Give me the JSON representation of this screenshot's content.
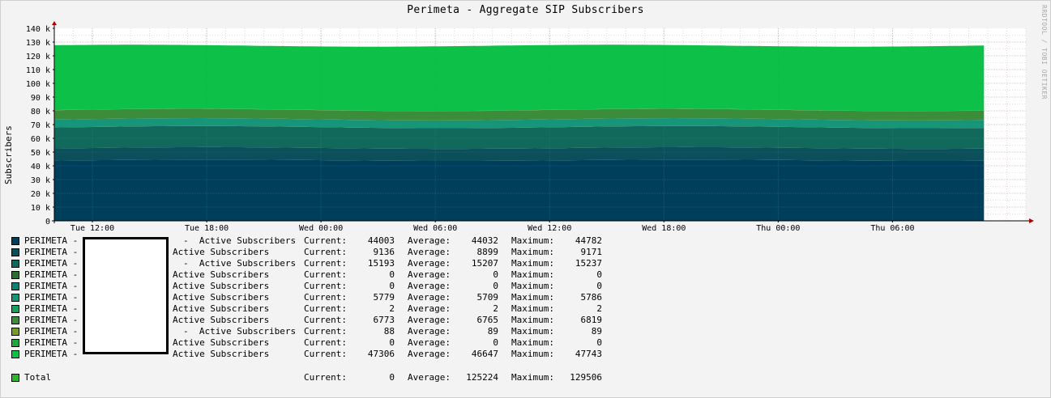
{
  "title": "Perimeta - Aggregate SIP Subscribers",
  "watermark": "RRDTOOL / TOBI OETIKER",
  "chart_data": {
    "type": "area",
    "stacked": true,
    "title": "Perimeta - Aggregate SIP Subscribers",
    "ylabel": "Subscribers",
    "xlabel": "",
    "ylim": [
      0,
      140000
    ],
    "y_ticks": [
      "0",
      "10 k",
      "20 k",
      "30 k",
      "40 k",
      "50 k",
      "60 k",
      "70 k",
      "80 k",
      "90 k",
      "100 k",
      "110 k",
      "120 k",
      "130 k",
      "140 k"
    ],
    "x_ticks": [
      "Tue 12:00",
      "Tue 18:00",
      "Wed 00:00",
      "Wed 06:00",
      "Wed 12:00",
      "Wed 18:00",
      "Thu 00:00",
      "Thu 06:00"
    ],
    "x_range_hours": [
      -2,
      49
    ],
    "grid": true,
    "series": [
      {
        "name": "PERIMETA -",
        "desc": "-  Active Subscribers",
        "color": "#003f5c",
        "current": 44003,
        "average": 44032,
        "maximum": 44782
      },
      {
        "name": "PERIMETA -",
        "desc": "Active Subscribers",
        "color": "#0b4f5b",
        "current": 9136,
        "average": 8899,
        "maximum": 9171
      },
      {
        "name": "PERIMETA -",
        "desc": "-  Active Subscribers",
        "color": "#10695a",
        "current": 15193,
        "average": 15207,
        "maximum": 15237
      },
      {
        "name": "PERIMETA -",
        "desc": "Active Subscribers",
        "color": "#2a6f2f",
        "current": 0,
        "average": 0,
        "maximum": 0
      },
      {
        "name": "PERIMETA -",
        "desc": "Active Subscribers",
        "color": "#127f75",
        "current": 0,
        "average": 0,
        "maximum": 0
      },
      {
        "name": "PERIMETA -",
        "desc": "Active Subscribers",
        "color": "#179578",
        "current": 5779,
        "average": 5709,
        "maximum": 5786
      },
      {
        "name": "PERIMETA -",
        "desc": "Active Subscribers",
        "color": "#17a15c",
        "current": 2,
        "average": 2,
        "maximum": 2
      },
      {
        "name": "PERIMETA -",
        "desc": "Active Subscribers",
        "color": "#3b8c3b",
        "current": 6773,
        "average": 6765,
        "maximum": 6819
      },
      {
        "name": "PERIMETA -",
        "desc": "-  Active Subscribers",
        "color": "#7a9a2a",
        "current": 88,
        "average": 89,
        "maximum": 89
      },
      {
        "name": "PERIMETA -",
        "desc": "Active Subscribers",
        "color": "#22a83a",
        "current": 0,
        "average": 0,
        "maximum": 0
      },
      {
        "name": "PERIMETA -",
        "desc": "Active Subscribers",
        "color": "#0cc048",
        "current": 47306,
        "average": 46647,
        "maximum": 47743
      }
    ],
    "total": {
      "name": "Total",
      "color": "#2db52d",
      "current": 0,
      "average": 125224,
      "maximum": 129506
    }
  },
  "labels": {
    "current": "Current:",
    "average": "Average:",
    "maximum": "Maximum:"
  }
}
